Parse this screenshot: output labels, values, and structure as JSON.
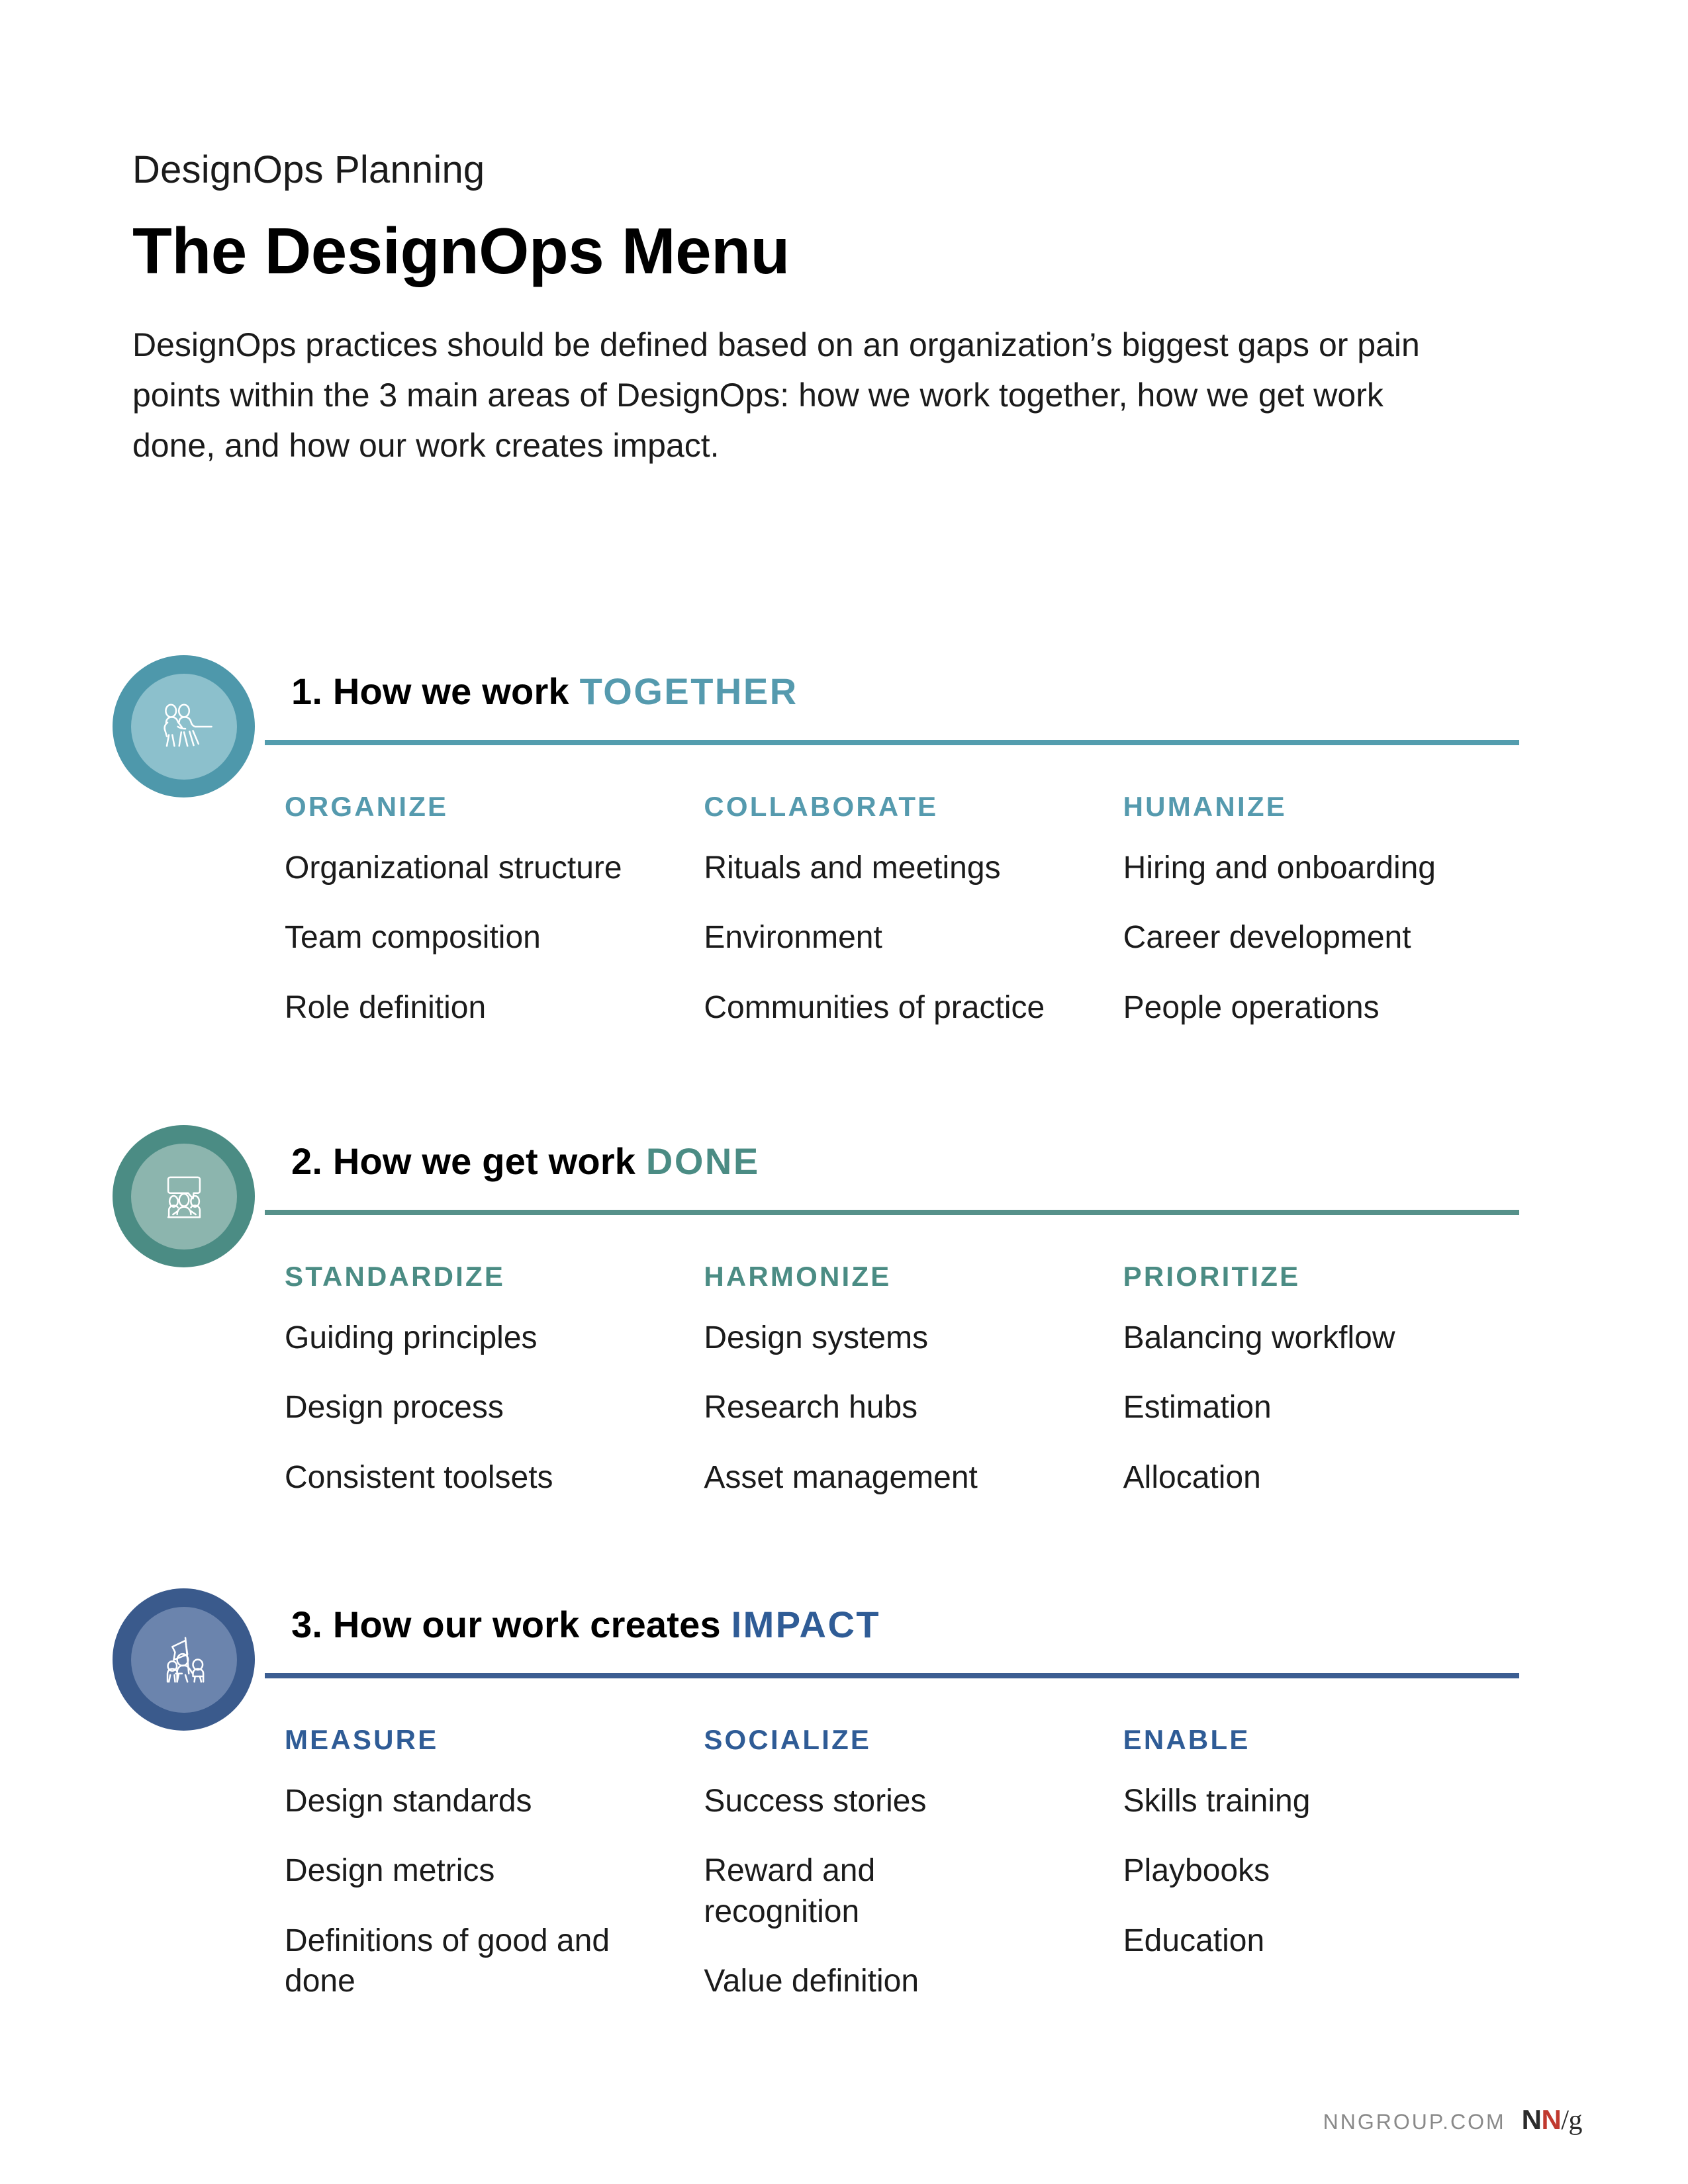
{
  "header": {
    "eyebrow": "DesignOps Planning",
    "title": "The DesignOps Menu",
    "intro": "DesignOps practices should be defined based on an organization’s biggest gaps or pain points within the 3 main areas of DesignOps: how we work together, how we get work done, and how our work creates impact."
  },
  "sections": [
    {
      "number": "1.",
      "heading_plain": "1. How we work",
      "heading_accent": "TOGETHER",
      "icon": "tug-of-war-icon",
      "color_outer": "#4e98ab",
      "color_inner": "#8cc0cc",
      "color_accent": "#559aae",
      "color_divider": "#539dae",
      "columns": [
        {
          "title": "ORGANIZE",
          "items": [
            "Organizational structure",
            "Team composition",
            "Role definition"
          ]
        },
        {
          "title": "COLLABORATE",
          "items": [
            "Rituals and meetings",
            "Environment",
            "Communities of practice"
          ]
        },
        {
          "title": "HUMANIZE",
          "items": [
            "Hiring and onboarding",
            "Career development",
            "People operations"
          ]
        }
      ]
    },
    {
      "number": "2.",
      "heading_plain": "2. How we get work",
      "heading_accent": "DONE",
      "icon": "presentation-meeting-icon",
      "color_outer": "#4b8c84",
      "color_inner": "#8cb5ae",
      "color_accent": "#4b8c84",
      "color_divider": "#56918a",
      "columns": [
        {
          "title": "STANDARDIZE",
          "items": [
            "Guiding principles",
            "Design process",
            "Consistent toolsets"
          ]
        },
        {
          "title": "HARMONIZE",
          "items": [
            "Design systems",
            "Research hubs",
            "Asset management"
          ]
        },
        {
          "title": "PRIORITIZE",
          "items": [
            "Balancing workflow",
            "Estimation",
            "Allocation"
          ]
        }
      ]
    },
    {
      "number": "3.",
      "heading_plain": "3. How our work creates",
      "heading_accent": "IMPACT",
      "icon": "flag-team-icon",
      "color_outer": "#3a5a8c",
      "color_inner": "#6b84ad",
      "color_accent": "#2f5c96",
      "color_divider": "#3c5e92",
      "columns": [
        {
          "title": "MEASURE",
          "items": [
            "Design standards",
            "Design metrics",
            "Definitions of good and done"
          ]
        },
        {
          "title": "SOCIALIZE",
          "items": [
            "Success stories",
            "Reward and recognition",
            "Value definition"
          ]
        },
        {
          "title": "ENABLE",
          "items": [
            "Skills training",
            "Playbooks",
            "Education"
          ]
        }
      ]
    }
  ],
  "footer": {
    "url": "NNGROUP.COM",
    "logo_n1": "N",
    "logo_n2": "N",
    "logo_slash": "/g"
  }
}
